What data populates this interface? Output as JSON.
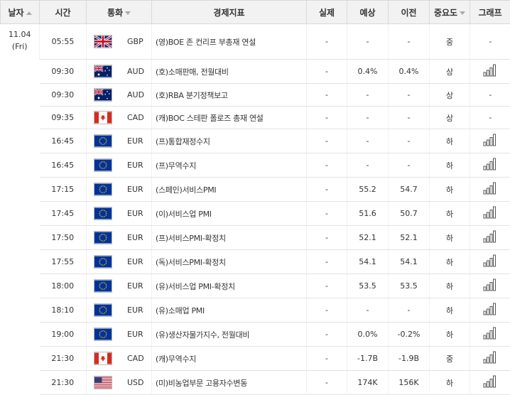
{
  "headers": {
    "date": "날자",
    "time": "시간",
    "currency": "통화",
    "indicator": "경제지표",
    "actual": "실제",
    "forecast": "예상",
    "previous": "이전",
    "importance": "중요도",
    "graph": "그래프"
  },
  "date_group": {
    "date": "11.04",
    "weekday": "(Fri)"
  },
  "rows": [
    {
      "time": "05:55",
      "flag": "uk-flag-icon",
      "currency": "GBP",
      "indicator": "(영)BOE 존 컨리프 부총재 연설",
      "actual": "-",
      "forecast": "-",
      "previous": "-",
      "importance": "중",
      "graph": "-"
    },
    {
      "time": "09:30",
      "flag": "au-flag-icon",
      "currency": "AUD",
      "indicator": "(호)소매판매, 전월대비",
      "actual": "-",
      "forecast": "0.4%",
      "previous": "0.4%",
      "importance": "상",
      "graph": "bar-chart-icon"
    },
    {
      "time": "09:30",
      "flag": "au-flag-icon",
      "currency": "AUD",
      "indicator": "(호)RBA 분기정책보고",
      "actual": "-",
      "forecast": "-",
      "previous": "-",
      "importance": "상",
      "graph": "-"
    },
    {
      "time": "09:35",
      "flag": "ca-flag-icon",
      "currency": "CAD",
      "indicator": "(캐)BOC 스테판 폴로즈 총재 연설",
      "actual": "-",
      "forecast": "-",
      "previous": "-",
      "importance": "상",
      "graph": "-"
    },
    {
      "time": "16:45",
      "flag": "eu-flag-icon",
      "currency": "EUR",
      "indicator": "(프)통합재정수지",
      "actual": "-",
      "forecast": "-",
      "previous": "-",
      "importance": "하",
      "graph": "bar-chart-icon"
    },
    {
      "time": "16:45",
      "flag": "eu-flag-icon",
      "currency": "EUR",
      "indicator": "(프)무역수지",
      "actual": "-",
      "forecast": "-",
      "previous": "-",
      "importance": "하",
      "graph": "bar-chart-icon"
    },
    {
      "time": "17:15",
      "flag": "eu-flag-icon",
      "currency": "EUR",
      "indicator": "(스페인)서비스PMI",
      "actual": "-",
      "forecast": "55.2",
      "previous": "54.7",
      "importance": "하",
      "graph": "bar-chart-icon"
    },
    {
      "time": "17:45",
      "flag": "eu-flag-icon",
      "currency": "EUR",
      "indicator": "(이)서비스업 PMI",
      "actual": "-",
      "forecast": "51.6",
      "previous": "50.7",
      "importance": "하",
      "graph": "bar-chart-icon"
    },
    {
      "time": "17:50",
      "flag": "eu-flag-icon",
      "currency": "EUR",
      "indicator": "(프)서비스PMI-확정치",
      "actual": "-",
      "forecast": "52.1",
      "previous": "52.1",
      "importance": "하",
      "graph": "bar-chart-icon"
    },
    {
      "time": "17:55",
      "flag": "eu-flag-icon",
      "currency": "EUR",
      "indicator": "(독)서비스PMI-확정치",
      "actual": "-",
      "forecast": "54.1",
      "previous": "54.1",
      "importance": "하",
      "graph": "bar-chart-icon"
    },
    {
      "time": "18:00",
      "flag": "eu-flag-icon",
      "currency": "EUR",
      "indicator": "(유)서비스업 PMI-확정치",
      "actual": "-",
      "forecast": "53.5",
      "previous": "53.5",
      "importance": "하",
      "graph": "bar-chart-icon"
    },
    {
      "time": "18:10",
      "flag": "eu-flag-icon",
      "currency": "EUR",
      "indicator": "(유)소매업 PMI",
      "actual": "-",
      "forecast": "-",
      "previous": "-",
      "importance": "하",
      "graph": "bar-chart-icon"
    },
    {
      "time": "19:00",
      "flag": "eu-flag-icon",
      "currency": "EUR",
      "indicator": "(유)생산자물가지수, 전월대비",
      "actual": "-",
      "forecast": "0.0%",
      "previous": "-0.2%",
      "importance": "하",
      "graph": "bar-chart-icon"
    },
    {
      "time": "21:30",
      "flag": "ca-flag-icon",
      "currency": "CAD",
      "indicator": "(캐)무역수지",
      "actual": "-",
      "forecast": "-1.7B",
      "previous": "-1.9B",
      "importance": "중",
      "graph": "bar-chart-icon"
    },
    {
      "time": "21:30",
      "flag": "us-flag-icon",
      "currency": "USD",
      "indicator": "(미)비농업부문 고용자수변동",
      "actual": "-",
      "forecast": "174K",
      "previous": "156K",
      "importance": "하",
      "graph": "bar-chart-icon"
    }
  ]
}
